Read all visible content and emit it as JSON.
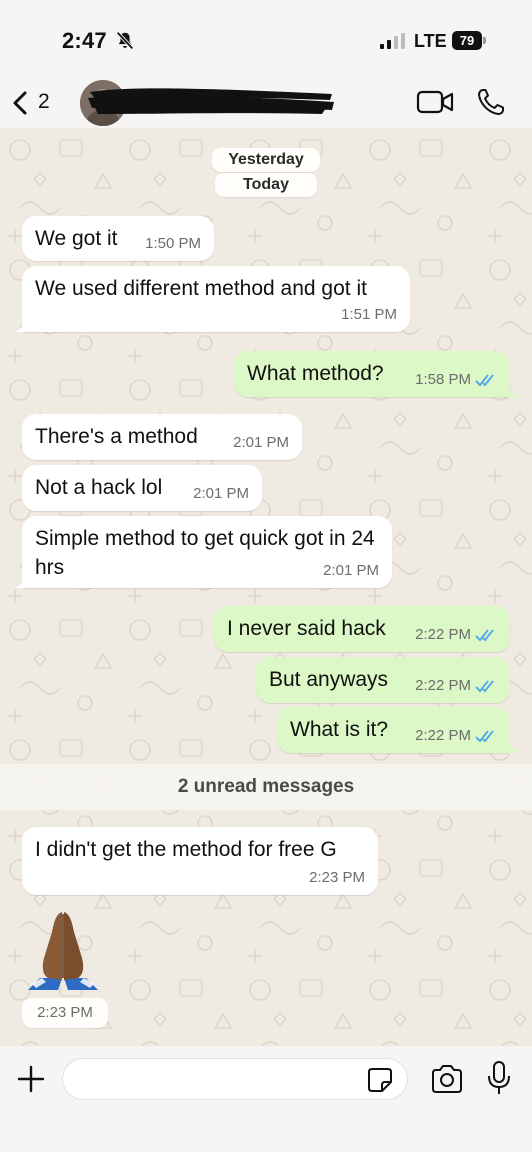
{
  "status_bar": {
    "time": "2:47",
    "carrier": "LTE",
    "battery": "79",
    "icons": [
      "bell-slash-icon",
      "signal-bars-icon",
      "battery-icon"
    ]
  },
  "header": {
    "back_count": "2",
    "contact_name": "",
    "icons": [
      "chevron-left-icon",
      "video-call-icon",
      "phone-icon"
    ]
  },
  "date_chips": [
    "Yesterday",
    "Today"
  ],
  "messages": [
    {
      "direction": "incoming",
      "text": "We got it",
      "time": "1:50 PM"
    },
    {
      "direction": "incoming",
      "text": "We used different method and got it",
      "time": "1:51 PM"
    },
    {
      "direction": "outgoing",
      "text": "What method?",
      "time": "1:58 PM",
      "read": true
    },
    {
      "direction": "incoming",
      "text": "There's a method",
      "time": "2:01 PM"
    },
    {
      "direction": "incoming",
      "text": "Not a hack lol",
      "time": "2:01 PM"
    },
    {
      "direction": "incoming",
      "text": "Simple method to get quick got in 24 hrs",
      "time": "2:01 PM"
    },
    {
      "direction": "outgoing",
      "text": "I never said hack",
      "time": "2:22 PM",
      "read": true
    },
    {
      "direction": "outgoing",
      "text": "But anyways",
      "time": "2:22 PM",
      "read": true
    },
    {
      "direction": "outgoing",
      "text": "What is it?",
      "time": "2:22 PM",
      "read": true
    },
    {
      "direction": "incoming",
      "text": "I didn't get the method for free G",
      "time": "2:23 PM"
    },
    {
      "direction": "incoming",
      "text": "",
      "emoji": "folded-hands",
      "time": "2:23 PM"
    }
  ],
  "unread_label": "2 unread messages",
  "input": {
    "value": "",
    "placeholder": "",
    "icons": [
      "plus-icon",
      "sticker-icon",
      "camera-icon",
      "microphone-icon"
    ]
  },
  "colors": {
    "incoming_bubble": "#ffffff",
    "outgoing_bubble": "#dbf8c6",
    "read_ticks": "#4aa3ec",
    "chat_background": "#efeae2"
  }
}
